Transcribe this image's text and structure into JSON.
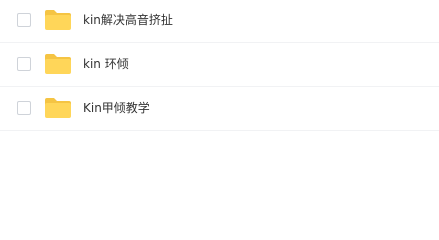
{
  "file_list": {
    "items": [
      {
        "name": "kin解决高音挤扯",
        "icon": "folder-icon",
        "checked": false
      },
      {
        "name": "kin 环倾",
        "icon": "folder-icon",
        "checked": false
      },
      {
        "name": "Kin甲倾教学",
        "icon": "folder-icon",
        "checked": false
      }
    ]
  },
  "colors": {
    "folder_body": "#FFD659",
    "folder_tab": "#F5C443",
    "checkbox_border": "#CFD3D9",
    "text": "#333333",
    "divider": "#F1F2F4"
  }
}
